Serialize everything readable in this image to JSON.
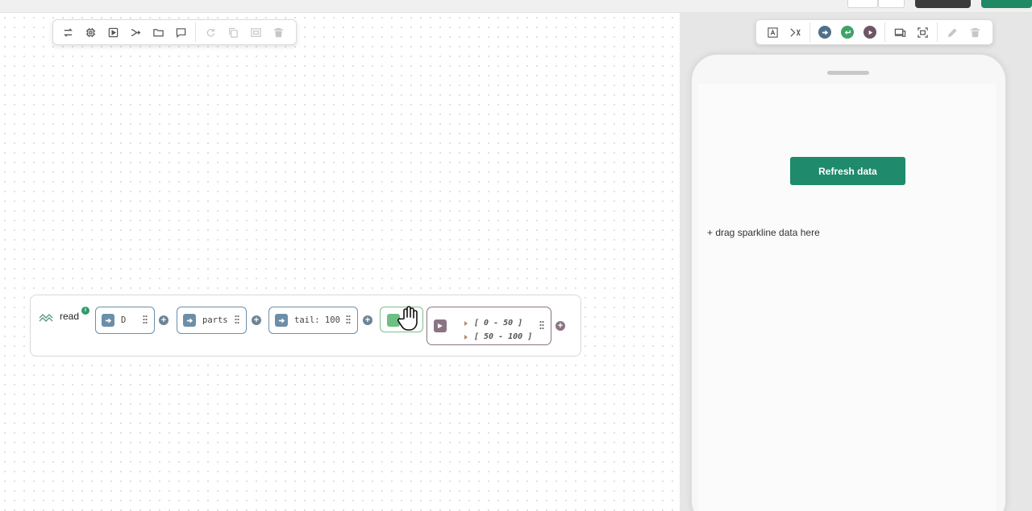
{
  "flow": {
    "label": "read",
    "info_badge": "i",
    "nodes": [
      {
        "label": "D"
      },
      {
        "label": "parts"
      },
      {
        "label": "tail: 100"
      }
    ],
    "output": {
      "ranges": [
        "[ 0 - 50 ]",
        "[ 50 - 100 ]"
      ]
    }
  },
  "preview": {
    "refresh_button": "Refresh data",
    "dropzone": "+ drag sparkline data here"
  },
  "icons": {
    "canvas_toolbar": [
      "swap-icon",
      "chip-icon",
      "play-box-icon",
      "merge-icon",
      "folder-icon",
      "comment-icon",
      "refresh-disabled-icon",
      "copy-disabled-icon",
      "frame-disabled-icon",
      "trash-disabled-icon"
    ],
    "preview_toolbar": [
      "text-frame-icon",
      "variable-icon",
      "input-circle-icon",
      "return-circle-icon",
      "output-circle-icon",
      "devices-icon",
      "fit-screen-icon",
      "edit-disabled-icon",
      "trash-disabled-icon"
    ]
  },
  "colors": {
    "primary_green": "#1f8a6c",
    "node_blue": "#6b8fa8",
    "return_green": "#6fbf84",
    "output_mauve": "#8a7483"
  }
}
